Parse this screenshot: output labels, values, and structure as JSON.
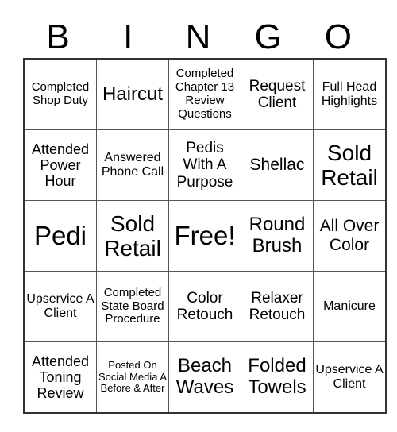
{
  "header": {
    "letters": [
      "B",
      "I",
      "N",
      "G",
      "O"
    ]
  },
  "board": {
    "rows": [
      [
        "Completed Shop Duty",
        "Haircut",
        "Completed Chapter 13 Review Questions",
        "Request Client",
        "Full Head Highlights"
      ],
      [
        "Attended Power Hour",
        "Answered Phone Call",
        "Pedis With A Purpose",
        "Shellac",
        "Sold Retail"
      ],
      [
        "Pedi",
        "Sold Retail",
        "Free!",
        "Round Brush",
        "All Over Color"
      ],
      [
        "Upservice A Client",
        "Completed State Board Procedure",
        "Color Retouch",
        "Relaxer Retouch",
        "Manicure"
      ],
      [
        "Attended Toning Review",
        "Posted On Social Media A Before & After",
        "Beach Waves",
        "Folded Towels",
        "Upservice A Client"
      ]
    ]
  }
}
